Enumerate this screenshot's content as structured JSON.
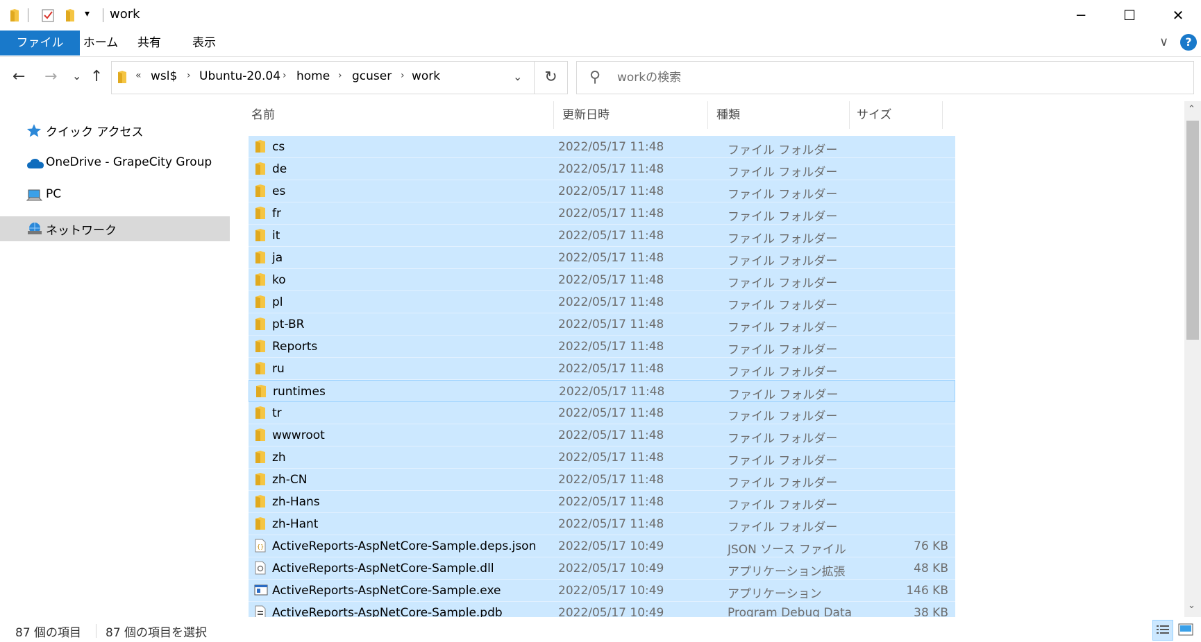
{
  "window": {
    "title": "work",
    "minimize_glyph": "─",
    "maximize_glyph": "☐",
    "close_glyph": "✕",
    "quick_access_dropdown": "▾"
  },
  "ribbon": {
    "tabs": [
      {
        "label": "ファイル"
      },
      {
        "label": "ホーム"
      },
      {
        "label": "共有"
      },
      {
        "label": "表示"
      }
    ],
    "collapse_glyph": "∨",
    "help_glyph": "?"
  },
  "navigation": {
    "back_glyph": "←",
    "forward_glyph": "→",
    "recent_glyph": "⌄",
    "up_glyph": "↑",
    "overflow_glyph": "«",
    "path": [
      "wsl$",
      "Ubuntu-20.04",
      "home",
      "gcuser",
      "work"
    ],
    "separator_glyph": "›",
    "dropdown_glyph": "⌄",
    "refresh_glyph": "↻"
  },
  "search": {
    "placeholder": "workの検索",
    "icon": "search-icon"
  },
  "sidebar": {
    "items": [
      {
        "label": "クイック アクセス",
        "icon": "star-icon",
        "selected": false
      },
      {
        "label": "OneDrive - GrapeCity Group",
        "icon": "cloud-icon",
        "selected": false
      },
      {
        "label": "PC",
        "icon": "computer-icon",
        "selected": false
      },
      {
        "label": "ネットワーク",
        "icon": "network-icon",
        "selected": true
      }
    ]
  },
  "columns": {
    "name": "名前",
    "date": "更新日時",
    "type": "種類",
    "size": "サイズ",
    "sort_glyph": "^"
  },
  "files": [
    {
      "name": "cs",
      "date": "2022/05/17 11:48",
      "type": "ファイル フォルダー",
      "size": "",
      "icon": "folder-icon"
    },
    {
      "name": "de",
      "date": "2022/05/17 11:48",
      "type": "ファイル フォルダー",
      "size": "",
      "icon": "folder-icon"
    },
    {
      "name": "es",
      "date": "2022/05/17 11:48",
      "type": "ファイル フォルダー",
      "size": "",
      "icon": "folder-icon"
    },
    {
      "name": "fr",
      "date": "2022/05/17 11:48",
      "type": "ファイル フォルダー",
      "size": "",
      "icon": "folder-icon"
    },
    {
      "name": "it",
      "date": "2022/05/17 11:48",
      "type": "ファイル フォルダー",
      "size": "",
      "icon": "folder-icon"
    },
    {
      "name": "ja",
      "date": "2022/05/17 11:48",
      "type": "ファイル フォルダー",
      "size": "",
      "icon": "folder-icon"
    },
    {
      "name": "ko",
      "date": "2022/05/17 11:48",
      "type": "ファイル フォルダー",
      "size": "",
      "icon": "folder-icon"
    },
    {
      "name": "pl",
      "date": "2022/05/17 11:48",
      "type": "ファイル フォルダー",
      "size": "",
      "icon": "folder-icon"
    },
    {
      "name": "pt-BR",
      "date": "2022/05/17 11:48",
      "type": "ファイル フォルダー",
      "size": "",
      "icon": "folder-icon"
    },
    {
      "name": "Reports",
      "date": "2022/05/17 11:48",
      "type": "ファイル フォルダー",
      "size": "",
      "icon": "folder-icon"
    },
    {
      "name": "ru",
      "date": "2022/05/17 11:48",
      "type": "ファイル フォルダー",
      "size": "",
      "icon": "folder-icon"
    },
    {
      "name": "runtimes",
      "date": "2022/05/17 11:48",
      "type": "ファイル フォルダー",
      "size": "",
      "icon": "folder-icon",
      "focused": true
    },
    {
      "name": "tr",
      "date": "2022/05/17 11:48",
      "type": "ファイル フォルダー",
      "size": "",
      "icon": "folder-icon"
    },
    {
      "name": "wwwroot",
      "date": "2022/05/17 11:48",
      "type": "ファイル フォルダー",
      "size": "",
      "icon": "folder-icon"
    },
    {
      "name": "zh",
      "date": "2022/05/17 11:48",
      "type": "ファイル フォルダー",
      "size": "",
      "icon": "folder-icon"
    },
    {
      "name": "zh-CN",
      "date": "2022/05/17 11:48",
      "type": "ファイル フォルダー",
      "size": "",
      "icon": "folder-icon"
    },
    {
      "name": "zh-Hans",
      "date": "2022/05/17 11:48",
      "type": "ファイル フォルダー",
      "size": "",
      "icon": "folder-icon"
    },
    {
      "name": "zh-Hant",
      "date": "2022/05/17 11:48",
      "type": "ファイル フォルダー",
      "size": "",
      "icon": "folder-icon"
    },
    {
      "name": "ActiveReports-AspNetCore-Sample.deps.json",
      "date": "2022/05/17 10:49",
      "type": "JSON ソース ファイル",
      "size": "76 KB",
      "icon": "json-file-icon"
    },
    {
      "name": "ActiveReports-AspNetCore-Sample.dll",
      "date": "2022/05/17 10:49",
      "type": "アプリケーション拡張",
      "size": "48 KB",
      "icon": "dll-file-icon"
    },
    {
      "name": "ActiveReports-AspNetCore-Sample.exe",
      "date": "2022/05/17 10:49",
      "type": "アプリケーション",
      "size": "146 KB",
      "icon": "exe-file-icon"
    },
    {
      "name": "ActiveReports-AspNetCore-Sample.pdb",
      "date": "2022/05/17 10:49",
      "type": "Program Debug Data",
      "size": "38 KB",
      "icon": "pdb-file-icon"
    }
  ],
  "scrollbar": {
    "up_glyph": "⌃",
    "down_glyph": "⌄"
  },
  "status": {
    "item_count": "87 個の項目",
    "selected_count": "87 個の項目を選択"
  },
  "colors": {
    "accent": "#1979ca",
    "selection": "#cce8ff",
    "folder": "#f5c543"
  }
}
